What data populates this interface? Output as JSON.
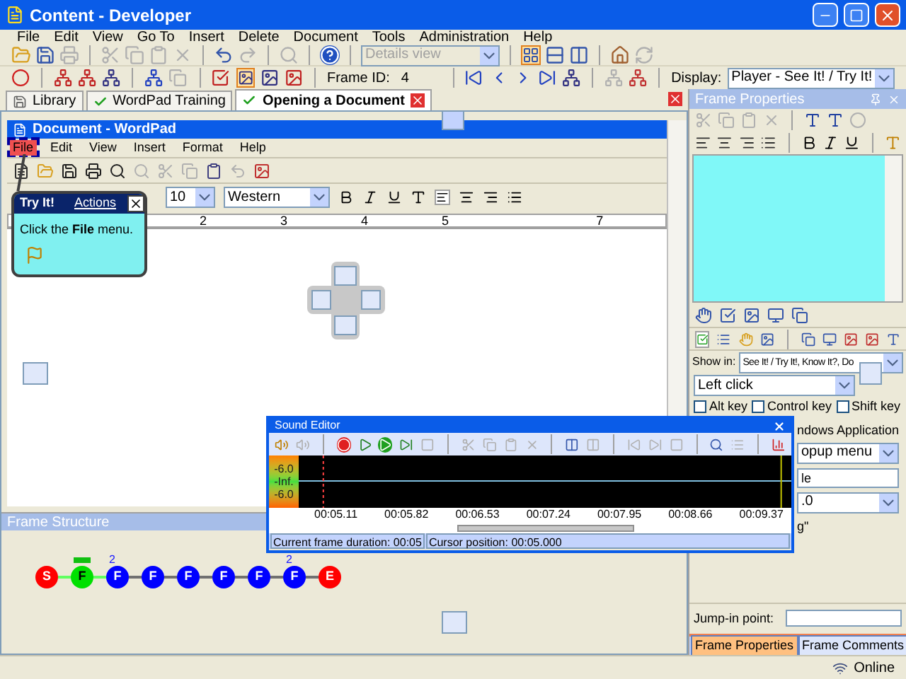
{
  "window": {
    "title": "Content - Developer"
  },
  "menu": [
    "File",
    "Edit",
    "View",
    "Go To",
    "Insert",
    "Delete",
    "Document",
    "Tools",
    "Administration",
    "Help"
  ],
  "toolbar": {
    "view_select": {
      "value": "Details view",
      "disabled": true
    },
    "frame_id_label": "Frame ID:",
    "frame_id": "4",
    "display_label": "Display:",
    "display": "Player - See It! / Try It!"
  },
  "tabs": [
    {
      "label": "Library",
      "selected": false,
      "checked": false
    },
    {
      "label": "WordPad Training",
      "selected": false,
      "checked": true
    },
    {
      "label": "Opening a Document",
      "selected": true,
      "checked": true
    }
  ],
  "document": {
    "title": "Document - WordPad",
    "menu": [
      {
        "label": "File",
        "selected": true
      },
      {
        "label": "Edit",
        "selected": false
      },
      {
        "label": "View",
        "selected": false
      },
      {
        "label": "Insert",
        "selected": false
      },
      {
        "label": "Format",
        "selected": false
      },
      {
        "label": "Help",
        "selected": false
      }
    ],
    "font_size": "10",
    "script": "Western",
    "ruler": [
      "2",
      "3",
      "4",
      "5",
      "7"
    ]
  },
  "bubble": {
    "title": "Try It!",
    "actions": "Actions",
    "text": "Click the **File** menu."
  },
  "frame_structure": {
    "title": "Frame Structure",
    "nodes": [
      {
        "label": "S",
        "color": "#ff0000",
        "selected": false
      },
      {
        "label": "F",
        "color": "#00e000",
        "selected": true
      },
      {
        "label": "F",
        "color": "#0000ff",
        "selected": false,
        "note": "2"
      },
      {
        "label": "F",
        "color": "#0000ff",
        "selected": false
      },
      {
        "label": "F",
        "color": "#0000ff",
        "selected": false
      },
      {
        "label": "F",
        "color": "#0000ff",
        "selected": false
      },
      {
        "label": "F",
        "color": "#0000ff",
        "selected": false
      },
      {
        "label": "F",
        "color": "#0000ff",
        "selected": false,
        "note": "2"
      },
      {
        "label": "E",
        "color": "#ff0000",
        "selected": false
      }
    ]
  },
  "frame_properties": {
    "title": "Frame Properties",
    "show_in_label": "Show in:",
    "show_in": "See It! / Try It!, Know It?, Do",
    "action": "Left click",
    "modifiers": [
      {
        "label": "Alt key",
        "checked": false
      },
      {
        "label": "Control key",
        "checked": false
      },
      {
        "label": "Shift key",
        "checked": false
      }
    ],
    "partial_rows": [
      {
        "kind": "text",
        "value": "ndows Application"
      },
      {
        "kind": "select",
        "value": "opup menu"
      },
      {
        "kind": "field",
        "value": "le"
      },
      {
        "kind": "select",
        "value": ".0"
      },
      {
        "kind": "text",
        "value": "g\""
      }
    ],
    "jump_in_label": "Jump-in point:",
    "tabs": [
      {
        "label": "Frame Properties",
        "selected": true
      },
      {
        "label": "Frame Comments",
        "selected": false
      }
    ]
  },
  "sound_editor": {
    "title": "Sound Editor",
    "levels": [
      "-6.0",
      "-Inf.",
      "-6.0"
    ],
    "times": [
      "00:05.11",
      "00:05.82",
      "00:06.53",
      "00:07.24",
      "00:07.95",
      "00:08.66",
      "00:09.37"
    ],
    "duration": "Current frame duration: 00:05",
    "cursor": "Cursor position: 00:05.000"
  },
  "status_bar": {
    "connection": "Online"
  }
}
